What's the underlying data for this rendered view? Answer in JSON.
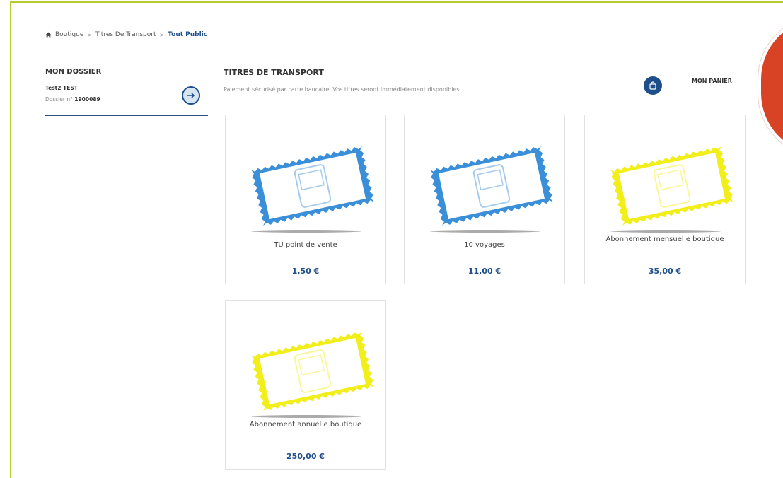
{
  "breadcrumb": {
    "home": "Boutique",
    "level2": "Titres De Transport",
    "current": "Tout Public",
    "separator": ">"
  },
  "sidebar": {
    "title": "MON DOSSIER",
    "user_name": "Test2 TEST",
    "dossier_label": "Dossier n°",
    "dossier_number": "1900089"
  },
  "main": {
    "title": "TITRES DE TRANSPORT",
    "subtitle": "Paiement sécurisé par carte bancaire. Vos titres seront immédiatement disponibles.",
    "cart_label": "MON PANIER"
  },
  "products": [
    {
      "name": "TU point de vente",
      "price": "1,50 €",
      "color": "#3a8fd8"
    },
    {
      "name": "10 voyages",
      "price": "11,00 €",
      "color": "#3a8fd8"
    },
    {
      "name": "Abonnement mensuel e boutique",
      "price": "35,00 €",
      "color": "#f2ee1a"
    },
    {
      "name": "Abonnement annuel e boutique",
      "price": "250,00 €",
      "color": "#f2ee1a"
    }
  ],
  "colors": {
    "accent": "#1f4f8b",
    "frame": "#b6cc2c",
    "badge": "#d84326"
  },
  "icons": {
    "home": "home-icon",
    "logout": "logout-icon",
    "cart": "shopping-bag-icon",
    "ticket": "bus-ticket-icon"
  }
}
